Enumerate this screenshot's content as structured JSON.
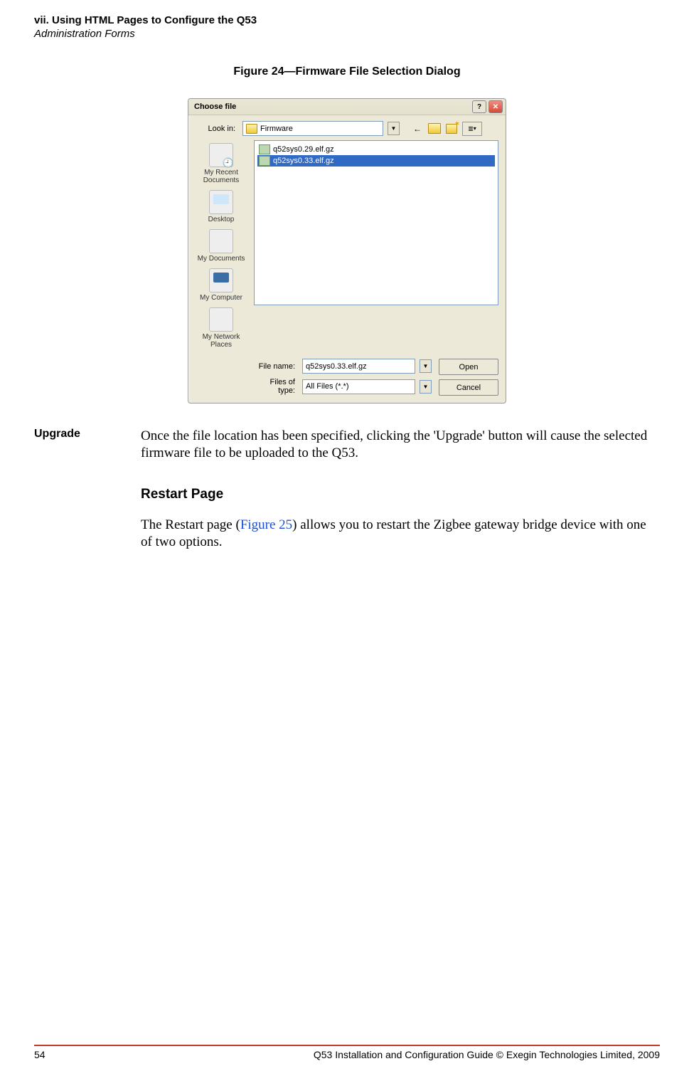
{
  "header": {
    "line1": "vii. Using HTML Pages to Configure the Q53",
    "line2": "Administration Forms"
  },
  "figure_caption": "Figure 24—Firmware File Selection Dialog",
  "dialog": {
    "title": "Choose file",
    "help_symbol": "?",
    "close_symbol": "✕",
    "lookin_label": "Look in:",
    "lookin_value": "Firmware",
    "files": [
      {
        "name": "q52sys0.29.elf.gz",
        "selected": false
      },
      {
        "name": "q52sys0.33.elf.gz",
        "selected": true
      }
    ],
    "places": {
      "recent": "My Recent Documents",
      "desktop": "Desktop",
      "documents": "My Documents",
      "computer": "My Computer",
      "network": "My Network Places"
    },
    "filename_label": "File name:",
    "filename_value": "q52sys0.33.elf.gz",
    "filetype_label": "Files of type:",
    "filetype_value": "All Files (*.*)",
    "open_btn": "Open",
    "cancel_btn": "Cancel"
  },
  "upgrade": {
    "label": "Upgrade",
    "text": "Once the file location has been specified, clicking the 'Upgrade' button will cause the selected firmware file to be uploaded to the Q53."
  },
  "restart": {
    "heading": "Restart Page",
    "text_pre": "The Restart page (",
    "link": "Figure 25",
    "text_post": ") allows you to restart the Zigbee gateway bridge device with one of two options."
  },
  "footer": {
    "page": "54",
    "text": "Q53 Installation and Configuration Guide  © Exegin Technologies Limited, 2009"
  }
}
